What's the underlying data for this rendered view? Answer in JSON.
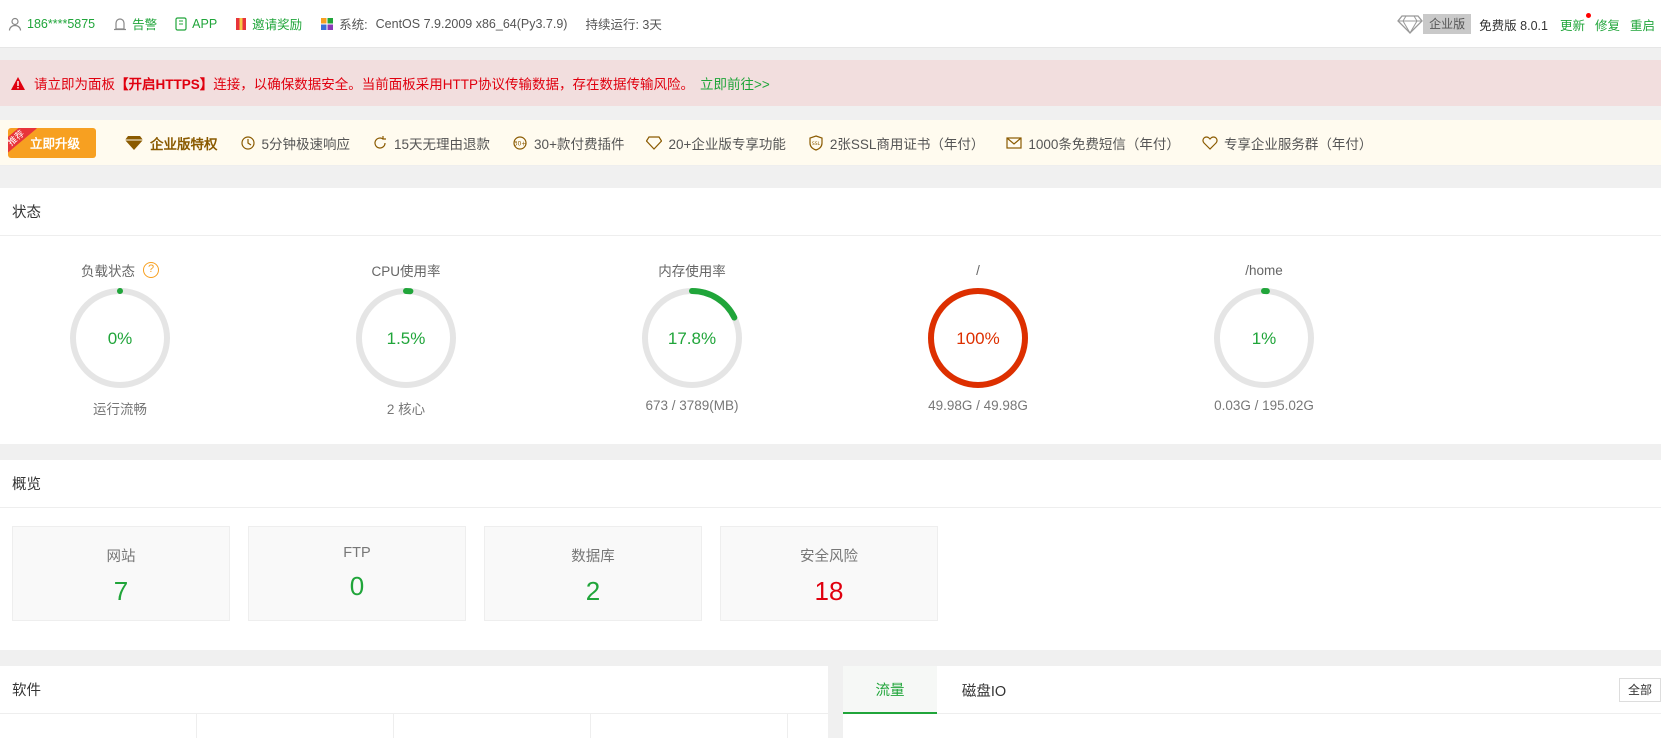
{
  "topbar": {
    "user": "186****5875",
    "alarm": "告警",
    "app": "APP",
    "invite": "邀请奖励",
    "system_label": "系统:",
    "system_value": "CentOS 7.9.2009 x86_64(Py3.7.9)",
    "uptime": "持续运行: 3天",
    "enterprise": "企业版",
    "version": "免费版 8.0.1",
    "update": "更新",
    "repair": "修复",
    "restart": "重启"
  },
  "warning": {
    "pre": "请立即为面板",
    "bold": "【开启HTTPS】",
    "post": "连接，以确保数据安全。当前面板采用HTTP协议传输数据，存在数据传输风险。",
    "link": "立即前往>>"
  },
  "enterprise_bar": {
    "ribbon": "推荐",
    "upgrade": "立即升级",
    "title": "企业版特权",
    "features": [
      "5分钟极速响应",
      "15天无理由退款",
      "30+款付费插件",
      "20+企业版专享功能",
      "2张SSL商用证书（年付）",
      "1000条免费短信（年付）",
      "专享企业服务群（年付）"
    ]
  },
  "status": {
    "title": "状态",
    "gauges": [
      {
        "title": "负载状态",
        "value": "0%",
        "percent": 0,
        "sub": "运行流畅",
        "color": "#20a53a",
        "help": "?"
      },
      {
        "title": "CPU使用率",
        "value": "1.5%",
        "percent": 1.5,
        "sub": "2 核心",
        "color": "#20a53a"
      },
      {
        "title": "内存使用率",
        "value": "17.8%",
        "percent": 17.8,
        "sub": "673 / 3789(MB)",
        "color": "#20a53a"
      },
      {
        "title": "/",
        "value": "100%",
        "percent": 100,
        "sub": "49.98G / 49.98G",
        "color": "#dd2f00"
      },
      {
        "title": "/home",
        "value": "1%",
        "percent": 1,
        "sub": "0.03G / 195.02G",
        "color": "#20a53a"
      }
    ]
  },
  "overview": {
    "title": "概览",
    "cards": [
      {
        "label": "网站",
        "value": "7"
      },
      {
        "label": "FTP",
        "value": "0"
      },
      {
        "label": "数据库",
        "value": "2"
      },
      {
        "label": "安全风险",
        "value": "18"
      }
    ]
  },
  "software": {
    "title": "软件"
  },
  "traffic": {
    "tabs": [
      "流量",
      "磁盘IO"
    ],
    "all": "全部"
  }
}
